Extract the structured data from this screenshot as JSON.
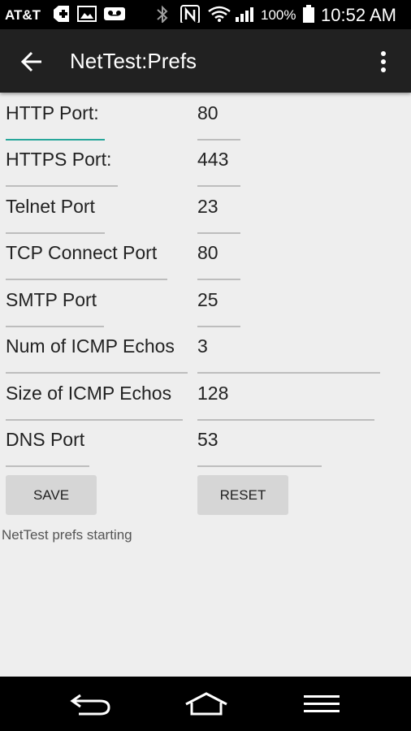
{
  "status_bar": {
    "carrier": "AT&T",
    "battery_percent": "100%",
    "time": "10:52 AM"
  },
  "action_bar": {
    "title": "NetTest:Prefs",
    "back_icon": "arrow-back-icon",
    "menu_icon": "overflow-menu-icon"
  },
  "prefs": [
    {
      "label": "HTTP Port:",
      "value": "80"
    },
    {
      "label": "HTTPS Port:",
      "value": "443"
    },
    {
      "label": "Telnet Port",
      "value": "23"
    },
    {
      "label": "TCP Connect Port",
      "value": "80"
    },
    {
      "label": "SMTP Port",
      "value": "25"
    },
    {
      "label": "Num of ICMP Echos",
      "value": "3"
    },
    {
      "label": "Size of ICMP Echos",
      "value": "128"
    },
    {
      "label": "DNS Port",
      "value": "53"
    }
  ],
  "buttons": {
    "save": "SAVE",
    "reset": "RESET"
  },
  "status_message": "NetTest prefs starting",
  "colors": {
    "focus_underline": "#26a69a",
    "action_bar": "#212121",
    "background": "#eeeeee"
  }
}
